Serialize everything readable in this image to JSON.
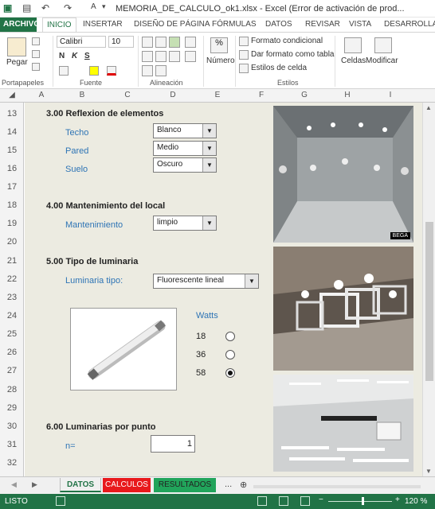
{
  "window": {
    "title": "MEMORIA_DE_CALCULO_ok1.xlsx - Excel (Error de activación de prod...",
    "help": "?",
    "minimize": "–",
    "restore": "❐",
    "close": "✕"
  },
  "ribbon_tabs": [
    "ARCHIVO",
    "INICIO",
    "INSERTAR",
    "DISEÑO DE PÁGINA",
    "FÓRMULAS",
    "DATOS",
    "REVISAR",
    "VISTA",
    "DESARROLLA"
  ],
  "ribbon": {
    "paste": "Pegar",
    "font_name": "Calibri",
    "font_size": "10",
    "bold": "N",
    "italic": "K",
    "underline": "S",
    "number": "Número",
    "cond_format": "Formato condicional",
    "format_table": "Dar formato como tabla",
    "cell_styles": "Estilos de celda",
    "cells": "Celdas",
    "modify": "Modificar",
    "groups": [
      "Portapapeles",
      "Fuente",
      "Alineación",
      "Estilos"
    ]
  },
  "columns": [
    "A",
    "B",
    "C",
    "D",
    "E",
    "F",
    "G",
    "H",
    "I"
  ],
  "rows": [
    "13",
    "14",
    "15",
    "16",
    "17",
    "18",
    "19",
    "20",
    "21",
    "22",
    "23",
    "24",
    "25",
    "26",
    "27",
    "28",
    "29",
    "30",
    "31",
    "32"
  ],
  "sheet": {
    "sec3_title": "3.00 Reflexion de elementos",
    "techo_label": "Techo",
    "techo_value": "Blanco",
    "pared_label": "Pared",
    "pared_value": "Medio",
    "suelo_label": "Suelo",
    "suelo_value": "Oscuro",
    "sec4_title": "4.00 Mantenimiento del local",
    "mant_label": "Mantenimiento",
    "mant_value": "limpio",
    "sec5_title": "5.00 Tipo de luminaria",
    "lum_label": "Luminaria tipo:",
    "lum_value": "Fluorescente lineal",
    "watts_label": "Watts",
    "watts_options": [
      "18",
      "36",
      "58"
    ],
    "watts_selected": "58",
    "sec6_title": "6.00 Luminarias por punto",
    "n_label": "n=",
    "n_value": "1",
    "photo1_caption": "BEGA"
  },
  "sheet_tabs": [
    "DATOS",
    "CALCULOS",
    "RESULTADOS"
  ],
  "sheet_tab_colors": [
    "#ffffff",
    "#e8191c",
    "#21a45b"
  ],
  "status": {
    "mode": "LISTO",
    "zoom": "120 %",
    "zoom_minus": "−",
    "zoom_plus": "+",
    "more_tabs": "..."
  }
}
